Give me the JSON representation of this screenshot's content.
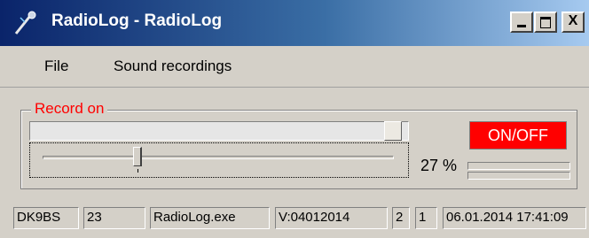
{
  "window": {
    "title": "RadioLog - RadioLog",
    "icon": "microphone-icon",
    "controls": {
      "minimize": "minimize-icon",
      "maximize": "maximize-icon",
      "close": "X"
    }
  },
  "menu": {
    "file": "File",
    "sound_recordings": "Sound recordings"
  },
  "record": {
    "group_label": "Record on",
    "level_fraction": 0.98,
    "volume_fraction": 0.27,
    "onoff_label": "ON/OFF",
    "percent_label": "27 %"
  },
  "status": {
    "callsign": "DK9BS",
    "number": "23",
    "exe": "RadioLog.exe",
    "version": "V:04012014",
    "field_a": "2",
    "field_b": "1",
    "datetime": "06.01.2014 17:41:09"
  },
  "colors": {
    "accent_label": "#ff0000",
    "onoff_bg": "#ff0000",
    "title_gradient_start": "#0a246a",
    "title_gradient_end": "#a6caf0"
  }
}
